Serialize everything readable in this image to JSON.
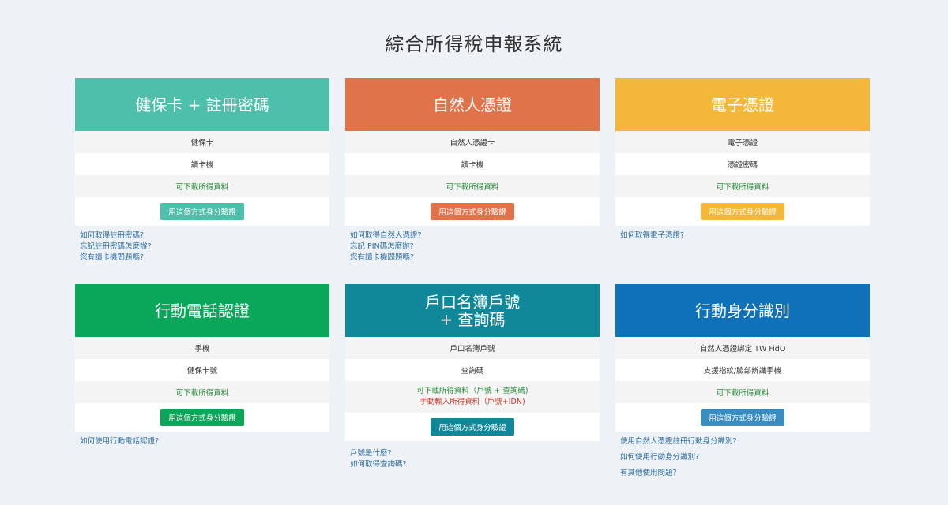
{
  "page": {
    "title": "綜合所得稅申報系統"
  },
  "cards": [
    {
      "title": "健保卡 + 註冊密碼",
      "color": "#4dbfab",
      "items": [
        "健保卡",
        "讀卡機"
      ],
      "download": "可下載所得資料",
      "button": "用這個方式身分驗證",
      "links": [
        "如何取得註冊密碼?",
        "忘記註冊密碼怎麼辦?",
        "您有讀卡機問題嗎?"
      ]
    },
    {
      "title": "自然人憑證",
      "color": "#e0734a",
      "items": [
        "自然人憑證卡",
        "讀卡機"
      ],
      "download": "可下載所得資料",
      "button": "用這個方式身分驗證",
      "links": [
        "如何取得自然人憑證?",
        "忘記 PIN碼怎麼辦?",
        "您有讀卡機問題嗎?"
      ]
    },
    {
      "title": "電子憑證",
      "color": "#f4b73a",
      "items": [
        "電子憑證",
        "憑證密碼"
      ],
      "download": "可下載所得資料",
      "button": "用這個方式身分驗證",
      "links": [
        "如何取得電子憑證?"
      ]
    },
    {
      "title": "行動電話認證",
      "color": "#0aa65a",
      "items": [
        "手機",
        "健保卡號"
      ],
      "download": "可下載所得資料",
      "button": "用這個方式身分驗證",
      "links": [
        "如何使用行動電話認證?"
      ]
    },
    {
      "title": "戶口名簿戶號\n+ 查詢碼",
      "color": "#11879a",
      "items": [
        "戶口名簿戶號",
        "查詢碼"
      ],
      "download": "可下載所得資料（戶號 + 查詢碼)",
      "download_note": "手動輸入所得資料（戶號+IDN)",
      "button": "用這個方式身分驗證",
      "links": [
        "戶號是什麼?",
        "如何取得查詢碼?"
      ]
    },
    {
      "title": "行動身分識別",
      "color": "#0f71b8",
      "button_color": "#3a8dc0",
      "items": [
        "自然人憑證綁定 TW FidO",
        "支援指紋/臉部辨識手機"
      ],
      "download": "可下載所得資料",
      "button": "用這個方式身分驗證",
      "links": [
        "使用自然人憑證註冊行動身分識別?",
        "如何使用行動身分識別?",
        "有其他使用問題?"
      ]
    }
  ]
}
